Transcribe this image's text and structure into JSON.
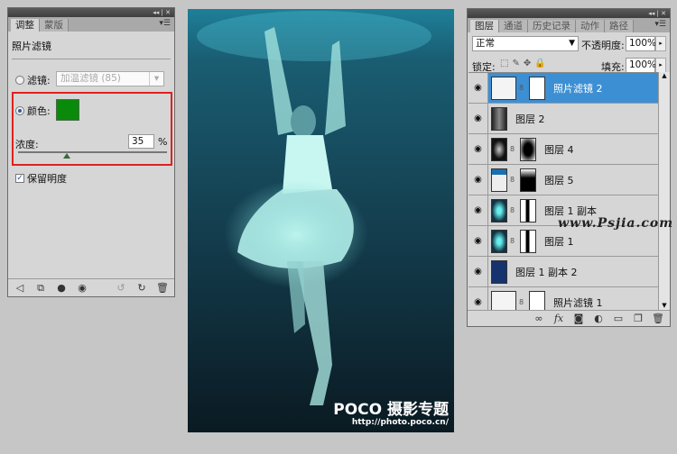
{
  "adjustments_panel": {
    "tabs": [
      "调整",
      "蒙版"
    ],
    "title": "照片滤镜",
    "filter_label": "滤镜:",
    "filter_value": "加温滤镜 (85)",
    "color_label": "颜色:",
    "color_value": "#0a8a0a",
    "density_label": "浓度:",
    "density_value": "35",
    "density_unit": "%",
    "density_percent": 35,
    "preserve_luminosity_label": "保留明度",
    "preserve_luminosity_checked": true,
    "mode": "color"
  },
  "photo": {
    "logo": "POCO 摄影专题",
    "url": "http://photo.poco.cn/"
  },
  "layers_panel": {
    "tabs": [
      "图层",
      "通道",
      "历史记录",
      "动作",
      "路径"
    ],
    "blend_mode": "正常",
    "opacity_label": "不透明度:",
    "opacity_value": "100%",
    "lock_label": "锁定:",
    "fill_label": "填充:",
    "fill_value": "100%",
    "layers": [
      {
        "name": "照片滤镜 2",
        "selected": true,
        "thumb": "adjustment",
        "mask": true
      },
      {
        "name": "图层 2",
        "thumb": "dark-blur",
        "mask": false
      },
      {
        "name": "图层 4",
        "thumb": "dark-spots",
        "mask": true
      },
      {
        "name": "图层 5",
        "thumb": "transparent-blue",
        "mask": true
      },
      {
        "name": "图层 1 副本",
        "thumb": "figure",
        "mask": true
      },
      {
        "name": "图层 1",
        "thumb": "figure",
        "mask": true
      },
      {
        "name": "图层 1 副本 2",
        "thumb": "blue-fill",
        "mask": false
      },
      {
        "name": "照片滤镜 1",
        "thumb": "adjustment",
        "mask": true
      }
    ]
  },
  "watermark": "www.Psjia.com"
}
